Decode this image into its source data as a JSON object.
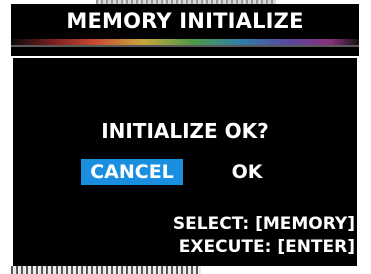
{
  "window": {
    "title": "MEMORY INITIALIZE"
  },
  "dialog": {
    "question": "INITIALIZE OK?",
    "buttons": {
      "cancel": "CANCEL",
      "ok": "OK"
    },
    "selected_button": "cancel",
    "hints": {
      "select": "SELECT: [MEMORY]",
      "execute": "EXECUTE: [ENTER]"
    }
  },
  "colors": {
    "background": "#000000",
    "text": "#ffffff",
    "highlight": "#1a8fe0"
  }
}
